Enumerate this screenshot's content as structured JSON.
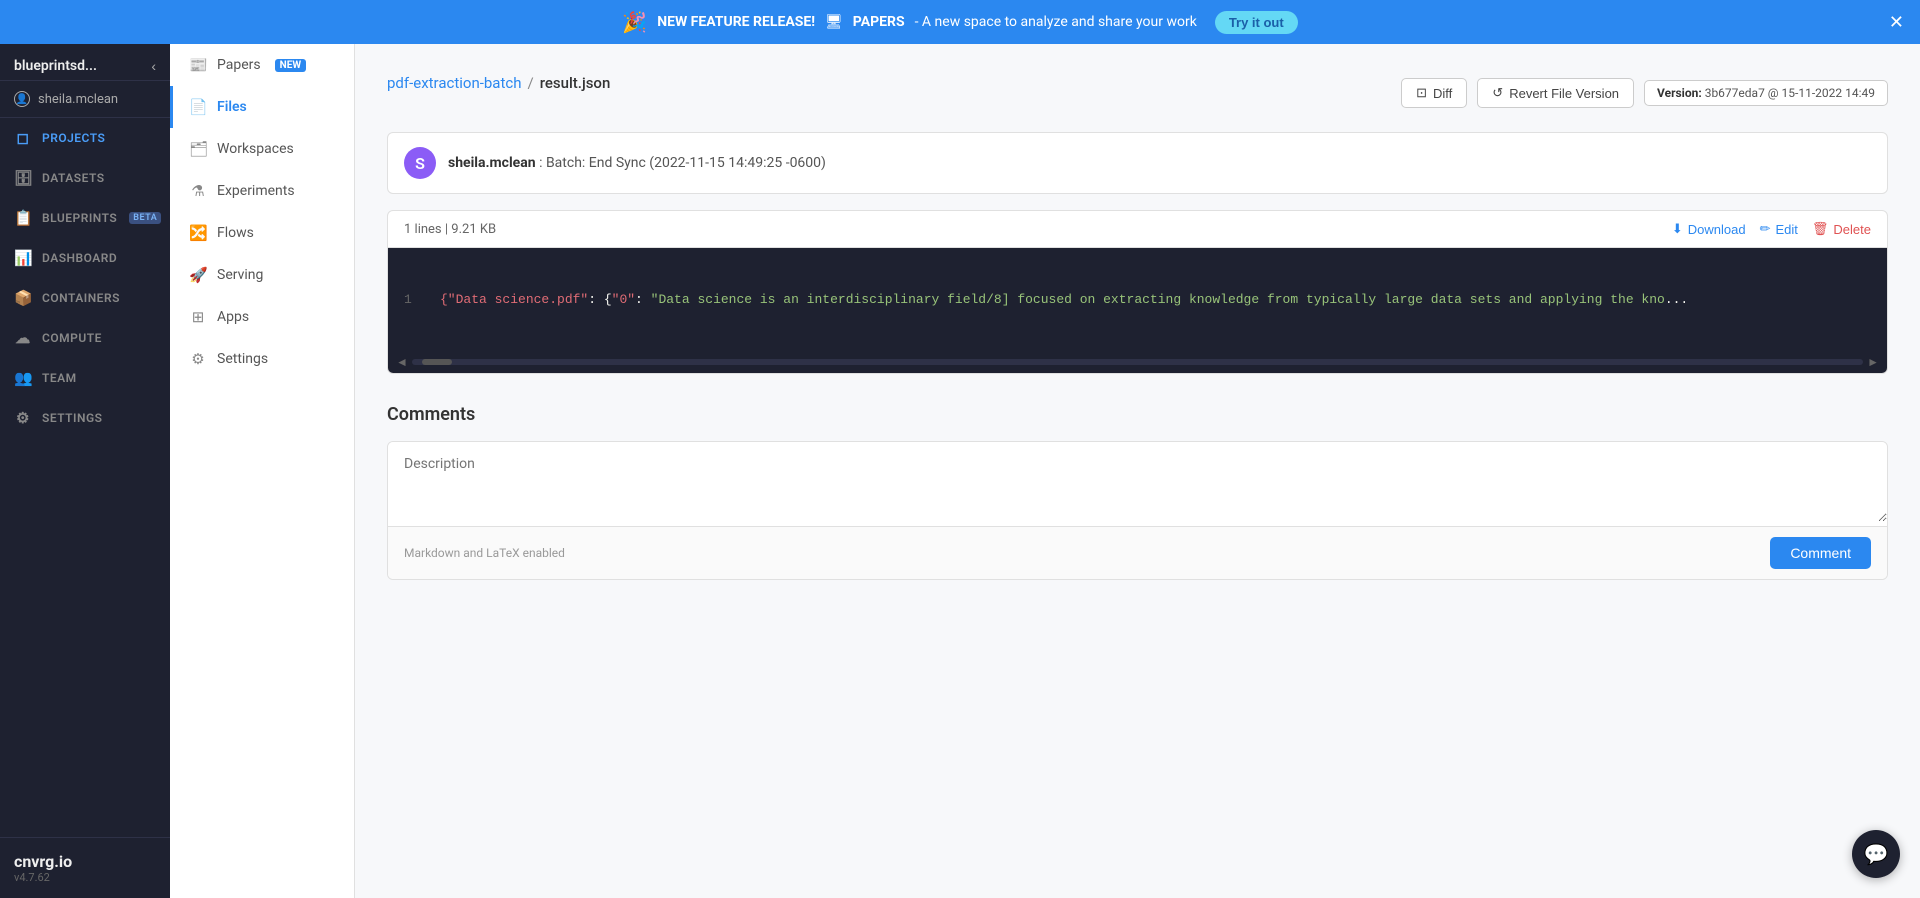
{
  "banner": {
    "icon": "🎉",
    "prefix": "NEW FEATURE RELEASE!",
    "monitor_icon": "🖥",
    "product": "PAPERS",
    "description": " - A new space to analyze and share your work",
    "try_label": "Try it out"
  },
  "left_sidebar": {
    "org_name": "blueprintsd...",
    "user": "sheila.mclean",
    "nav_items": [
      {
        "id": "projects",
        "label": "PROJECTS",
        "icon": "◻",
        "active": true
      },
      {
        "id": "datasets",
        "label": "DATASETS",
        "icon": "🗄"
      },
      {
        "id": "blueprints",
        "label": "BLUEPRINTS",
        "icon": "📋",
        "badge": "BETA"
      },
      {
        "id": "dashboard",
        "label": "DASHBOARD",
        "icon": "📊"
      },
      {
        "id": "containers",
        "label": "CONTAINERS",
        "icon": "📦"
      },
      {
        "id": "compute",
        "label": "COMPUTE",
        "icon": "☁"
      },
      {
        "id": "team",
        "label": "TEAM",
        "icon": "👥"
      },
      {
        "id": "settings",
        "label": "SETTINGS",
        "icon": "⚙"
      }
    ],
    "brand": "cnvrg.io",
    "version": "v4.7.62"
  },
  "second_sidebar": {
    "items": [
      {
        "id": "papers",
        "label": "Papers",
        "icon": "📰",
        "badge": "NEW"
      },
      {
        "id": "files",
        "label": "Files",
        "icon": "📄",
        "active": true
      },
      {
        "id": "workspaces",
        "label": "Workspaces",
        "icon": "🗂"
      },
      {
        "id": "experiments",
        "label": "Experiments",
        "icon": "⚗"
      },
      {
        "id": "flows",
        "label": "Flows",
        "icon": "🔀"
      },
      {
        "id": "serving",
        "label": "Serving",
        "icon": "🚀"
      },
      {
        "id": "apps",
        "label": "Apps",
        "icon": "⊞"
      },
      {
        "id": "settings_proj",
        "label": "Settings",
        "icon": "⚙"
      }
    ]
  },
  "breadcrumb": {
    "project": "pdf-extraction-batch",
    "separator": "/",
    "file": "result.json"
  },
  "toolbar": {
    "diff_label": "Diff",
    "revert_label": "Revert File Version",
    "version_label": "Version:",
    "version_value": "3b677eda7 @ 15-11-2022 14:49"
  },
  "commit": {
    "avatar_letter": "S",
    "avatar_color": "#8b5cf6",
    "author": "sheila.mclean",
    "message": ": Batch: End Sync (2022-11-15 14:49:25 -0600)"
  },
  "file_meta": {
    "lines": "1 lines",
    "size": "9.21 KB",
    "download_label": "Download",
    "edit_label": "Edit",
    "delete_label": "Delete"
  },
  "code": {
    "line_number": "1",
    "content": "{\"Data science.pdf\": {\"0\": \"Data science is an interdisciplinary field/8] focused on extracting knowledge from typically large data sets and applying the kno"
  },
  "comments": {
    "title": "Comments",
    "placeholder": "Description",
    "hint": "Markdown and LaTeX enabled",
    "button_label": "Comment"
  }
}
